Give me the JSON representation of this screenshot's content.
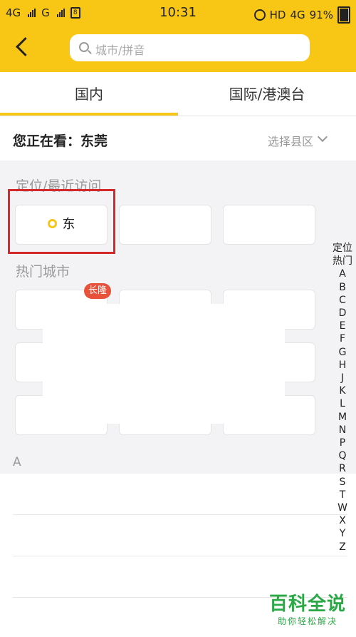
{
  "status_bar": {
    "network1": "4G",
    "network2": "G",
    "time": "10:31",
    "hd": "HD",
    "net4g": "4G",
    "battery": "91%"
  },
  "header": {
    "search_placeholder": "城市/拼音"
  },
  "tabs": [
    {
      "label": "国内"
    },
    {
      "label": "国际/港澳台"
    }
  ],
  "viewing": {
    "label": "您正在看：东莞",
    "select_district": "选择县区"
  },
  "location_section": {
    "title": "定位/最近访问",
    "cities": [
      "东",
      "",
      ""
    ]
  },
  "hot_section": {
    "title": "热门城市",
    "badge": "长隆"
  },
  "alpha_section": {
    "letter": "A",
    "rows": [
      "",
      "",
      "",
      ""
    ]
  },
  "index": [
    "定位",
    "热门",
    "A",
    "B",
    "C",
    "D",
    "E",
    "F",
    "G",
    "H",
    "J",
    "K",
    "L",
    "M",
    "N",
    "P",
    "Q",
    "R",
    "S",
    "T",
    "W",
    "X",
    "Y",
    "Z"
  ],
  "watermark": {
    "big": "百科全说",
    "small": "助你轻松解决"
  },
  "colors": {
    "accent": "#f8c716",
    "badge": "#e8523b",
    "highlight": "#d4282c"
  }
}
